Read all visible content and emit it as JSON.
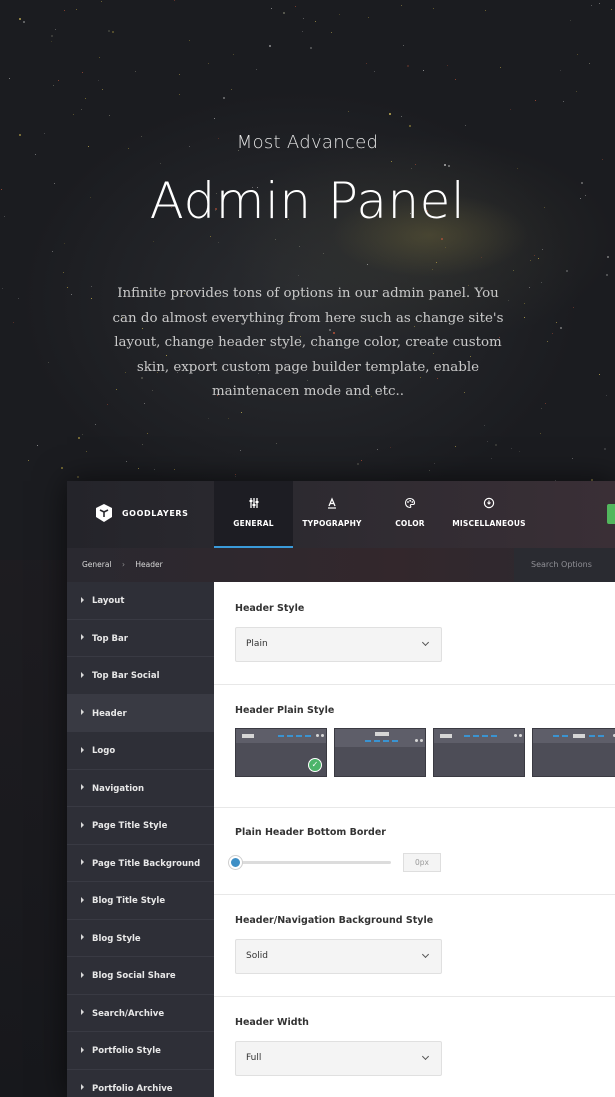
{
  "hero": {
    "subtitle": "Most Advanced",
    "title": "Admin Panel",
    "description": "Infinite provides tons of options in our admin panel. You can do almost everything from here such as change site's layout, change header style, change color, create custom skin, export custom page builder template, enable maintenacen mode and etc.."
  },
  "admin": {
    "logo_text": "GOODLAYERS",
    "tabs": [
      {
        "label": "GENERAL",
        "icon": "sliders-icon",
        "active": true
      },
      {
        "label": "TYPOGRAPHY",
        "icon": "font-icon",
        "active": false
      },
      {
        "label": "COLOR",
        "icon": "palette-icon",
        "active": false
      },
      {
        "label": "MISCELLANEOUS",
        "icon": "misc-icon",
        "active": false
      }
    ],
    "breadcrumb": [
      "General",
      "Header"
    ],
    "breadcrumb_separator": "›",
    "search_placeholder": "Search Options",
    "sidebar": [
      "Layout",
      "Top Bar",
      "Top Bar Social",
      "Header",
      "Logo",
      "Navigation",
      "Page Title Style",
      "Page Title Background",
      "Blog Title Style",
      "Blog Style",
      "Blog Social Share",
      "Search/Archive",
      "Portfolio Style",
      "Portfolio Archive"
    ],
    "sidebar_active": "Header",
    "options": {
      "header_style": {
        "label": "Header Style",
        "value": "Plain"
      },
      "header_plain_style": {
        "label": "Header Plain Style",
        "selected_index": 0
      },
      "bottom_border": {
        "label": "Plain Header Bottom Border",
        "value": "0px",
        "slider_fraction": 0
      },
      "nav_bg": {
        "label": "Header/Navigation Background Style",
        "value": "Solid"
      },
      "header_width": {
        "label": "Header Width",
        "value": "Full"
      }
    }
  },
  "colors": {
    "accent": "#3a9ad9",
    "sidebar_bg": "#2e2f37",
    "check_green": "#4cb56a"
  }
}
